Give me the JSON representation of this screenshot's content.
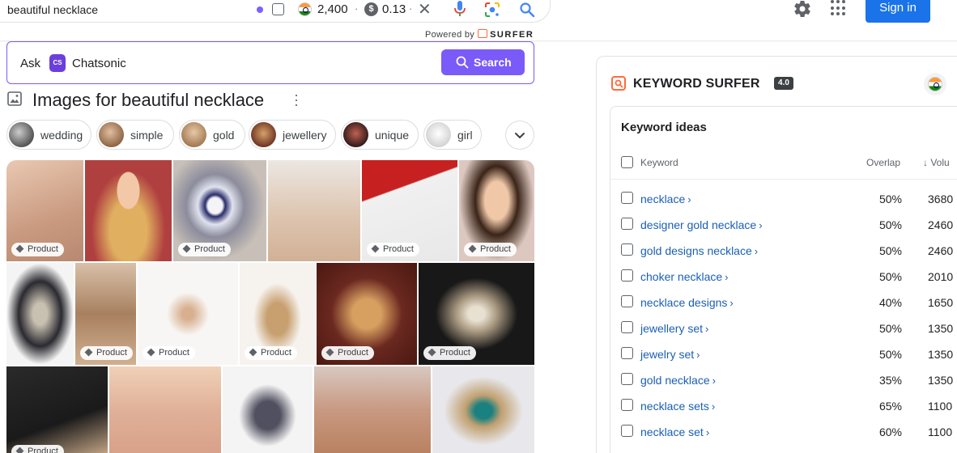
{
  "search": {
    "query": "beautiful necklace",
    "count": "2,400",
    "cost": "0.13",
    "powered_by": "Powered by",
    "brand": "SURFER"
  },
  "header": {
    "signin_label": "Sign in"
  },
  "chatsonic": {
    "ask": "Ask",
    "name": "Chatsonic",
    "search_label": "Search"
  },
  "images": {
    "title": "Images for beautiful necklace",
    "chips": [
      {
        "label": "wedding",
        "color": "#6b6b6b"
      },
      {
        "label": "simple",
        "color": "#a07a5a"
      },
      {
        "label": "gold",
        "color": "#b89068"
      },
      {
        "label": "jewellery",
        "color": "#7a4a3a"
      },
      {
        "label": "unique",
        "color": "#5a3a3a"
      },
      {
        "label": "girl",
        "color": "#e8e8e8"
      }
    ],
    "badge": "Product"
  },
  "keyword_surfer": {
    "title": "KEYWORD SURFER",
    "version": "4.0",
    "ideas_heading": "Keyword ideas",
    "col_keyword": "Keyword",
    "col_overlap": "Overlap",
    "col_volume": "↓ Volu",
    "rows": [
      {
        "keyword": "necklace",
        "overlap": "50%",
        "volume": "3680"
      },
      {
        "keyword": "designer gold necklace",
        "overlap": "50%",
        "volume": "2460"
      },
      {
        "keyword": "gold designs necklace",
        "overlap": "50%",
        "volume": "2460"
      },
      {
        "keyword": "choker necklace",
        "overlap": "50%",
        "volume": "2010"
      },
      {
        "keyword": "necklace designs",
        "overlap": "40%",
        "volume": "1650"
      },
      {
        "keyword": "jewellery set",
        "overlap": "50%",
        "volume": "1350"
      },
      {
        "keyword": "jewelry set",
        "overlap": "50%",
        "volume": "1350"
      },
      {
        "keyword": "gold necklace",
        "overlap": "35%",
        "volume": "1350"
      },
      {
        "keyword": "necklace sets",
        "overlap": "65%",
        "volume": "1100"
      },
      {
        "keyword": "necklace set",
        "overlap": "60%",
        "volume": "1100"
      }
    ]
  }
}
